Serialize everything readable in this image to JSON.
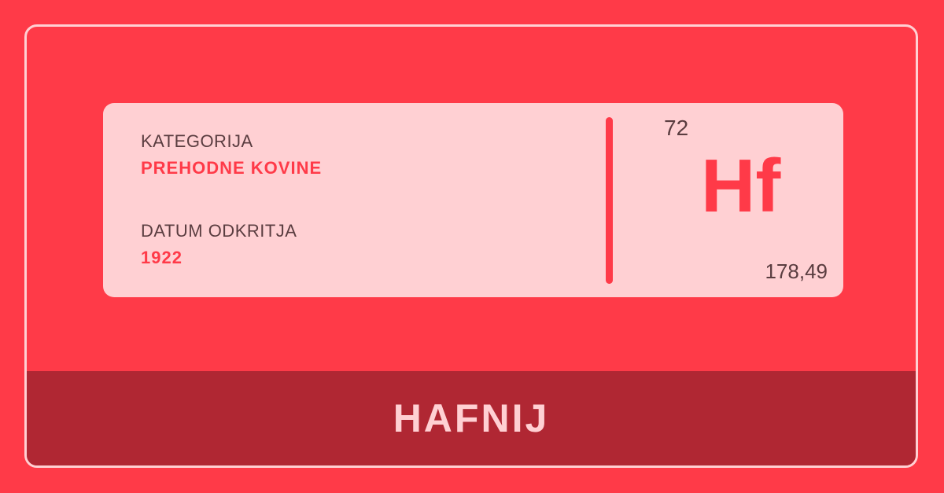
{
  "element": {
    "category_label": "KATEGORIJA",
    "category_value": "PREHODNE KOVINE",
    "discovery_label": "DATUM ODKRITJA",
    "discovery_value": "1922",
    "atomic_number": "72",
    "symbol": "Hf",
    "atomic_mass": "178,49",
    "name": "HAFNIJ"
  },
  "colors": {
    "background": "#ff3a48",
    "card": "#ffd0d3",
    "footer": "#b02733",
    "text_dark": "#5a3d40"
  }
}
